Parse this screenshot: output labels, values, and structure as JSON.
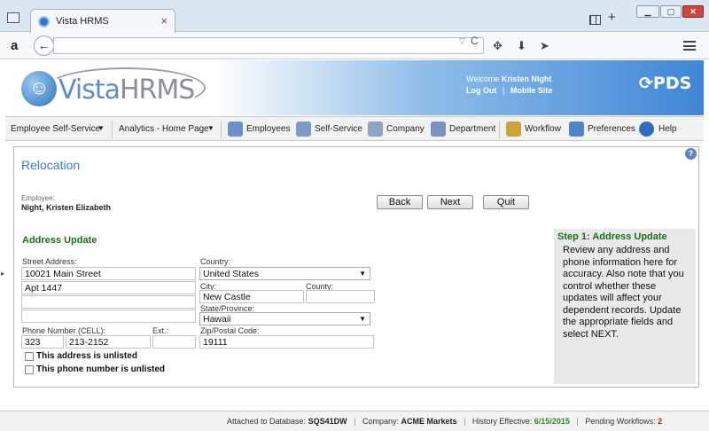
{
  "browser": {
    "tab_title": "Vista HRMS",
    "tab_close": "×",
    "new_tab": "+",
    "amazon_glyph": "a",
    "back_glyph": "←",
    "url": "",
    "reload_glyph": "C",
    "icons": [
      "window-icon",
      "tab-favicon",
      "tab-groups-icon",
      "back-icon",
      "reload-icon",
      "crosshair-icon",
      "download-icon",
      "send-icon",
      "menu-icon"
    ]
  },
  "header": {
    "logo_prefix": "Vista",
    "logo_suffix": "HRMS",
    "welcome_label": "Welcome",
    "user_name": "Kristen Night",
    "log_out": "Log Out",
    "link_sep": "|",
    "mobile_site": "Mobile Site",
    "brand": "PDS"
  },
  "menu": {
    "employee_self_service": "Employee Self-Service",
    "analytics_home": "Analytics - Home Page",
    "employees": "Employees",
    "self_service": "Self-Service",
    "company": "Company",
    "department": "Department",
    "workflow": "Workflow",
    "preferences": "Preferences",
    "help": "Help",
    "dropdown_glyph": "▼"
  },
  "page": {
    "title": "Relocation",
    "help_glyph": "?",
    "employee_label": "Employee:",
    "employee_name": "Night, Kristen Elizabeth",
    "buttons": {
      "back": "Back",
      "next": "Next",
      "quit": "Quit"
    }
  },
  "form": {
    "section_title": "Address Update",
    "street_label": "Street Address:",
    "street1": "10021 Main Street",
    "street2": "Apt 1447",
    "street3": "",
    "street4": "",
    "country_label": "Country:",
    "country": "United States",
    "city_label": "City:",
    "city": "New Castle",
    "county_label": "County:",
    "county": "",
    "state_label": "State/Province:",
    "state": "Hawaii",
    "zip_label": "Zip/Postal Code:",
    "zip": "19111",
    "phone_label": "Phone Number (CELL):",
    "phone_area": "323",
    "phone_number": "213-2152",
    "ext_label": "Ext.:",
    "ext": "",
    "address_unlisted": "This address is unlisted",
    "phone_unlisted": "This phone number is unlisted",
    "address_unlisted_checked": false,
    "phone_unlisted_checked": false
  },
  "sidebar": {
    "title": "Step 1: Address Update",
    "text": "Review any address and phone information here for accuracy. Also note that you control whether these updates will affect your dependent records. Update the appropriate fields and select NEXT."
  },
  "status": {
    "db_label": "Attached to Database:",
    "db_value": "SQS41DW",
    "company_label": "Company:",
    "company_value": "ACME Markets",
    "history_label": "History Effective:",
    "history_value": "6/15/2015",
    "pending_label": "Pending Workflows:",
    "pending_value": "2",
    "sep": "|"
  },
  "colors": {
    "accent_blue": "#3b7dc8",
    "section_green": "#187118",
    "pending_red": "#b21c1c",
    "header_gradient_end": "#3f86d6"
  }
}
